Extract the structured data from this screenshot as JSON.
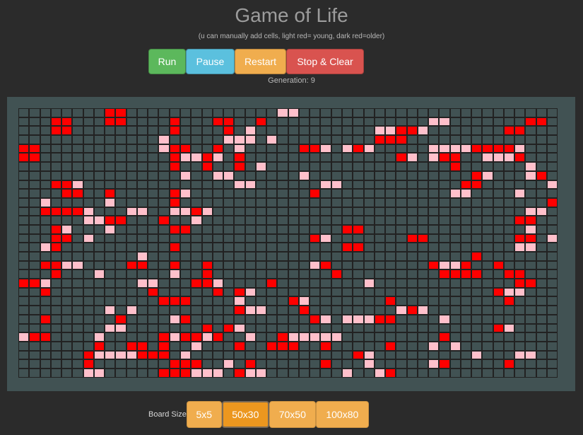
{
  "header": {
    "title": "Game of Life",
    "subtitle": "(u can manually add cells, light red= young, dark red=older)"
  },
  "controls": {
    "run_label": "Run",
    "pause_label": "Pause",
    "restart_label": "Restart",
    "clear_label": "Stop & Clear"
  },
  "status": {
    "generation_text": "Generation: 9"
  },
  "board": {
    "cols": 50,
    "rows": 30,
    "colors": {
      "dead": "#415253",
      "young": "#ffc0cb",
      "old": "#ff0000",
      "border": "#222222"
    },
    "cells": [
      "........OO..............YY........................",
      "...OO...OO....O...OO..O...............YY.......OO.",
      "...OO.........O....O.Y...........YYOOY.......OO...",
      ".............Y.....YYY.Y.........OOO.............",
      "OO...........YOO..O.Y.....OOY.YOY.....YYYYOOOOY...",
      "OO............OYYOY.O..............OY.YOO..YYYO...",
      "..............O..O..O.Y.................O......Y...",
      "...............Y..YY......Y...............OY...YO..",
      "...OOY..............YY......YY...........OO......Y.",
      "....OO..O.....OY...........O............YY....Y...",
      "..Y.....Y.....O..................................O",
      "..OOOOY...YY..YYOY.............................YY.",
      "......YYOO...O..Y.............................OO..",
      "...OY...Y.....OO..............OO...............Y..",
      "...OO.Y....................OY.......OO........OO.Y.",
      "..YO..........O...............OO..............YY..",
      "...........Y..............................O.......",
      "..OOYY....OO..O..O.........YO.........OYYO..O.....",
      "...O...Y......Y..O...........O.........OOOO..OO...",
      "OOY........YY...OOY....O........Y.............OO..",
      "..O.........O.....O.OY......................OYY...",
      ".............OOO....Y....OY.......O..........O.....",
      "........Y.Y.........OYY...O........YOY...........",
      "..O......O....YO...........OY.YYYOO....Y..........",
      "........YY.......O.OY.......................OY.....",
      "YOO....Y.....OYOOYO..Y..OYYYYY.........O..........",
      ".......O..OO.O..Y...O..OOO..O.....O...Y.Y........",
      "......OYYYYOOO.Y...............OY.........Y...YY..",
      "......O.......OOO..Y.O......O...Y.....YO.....O....",
      "......YY.....OOOYYY.OYY.......Y..YO..............."
    ]
  },
  "board_size": {
    "label": "Board Size",
    "options": [
      "5x5",
      "50x30",
      "70x50",
      "100x80"
    ],
    "selected": "50x30"
  }
}
